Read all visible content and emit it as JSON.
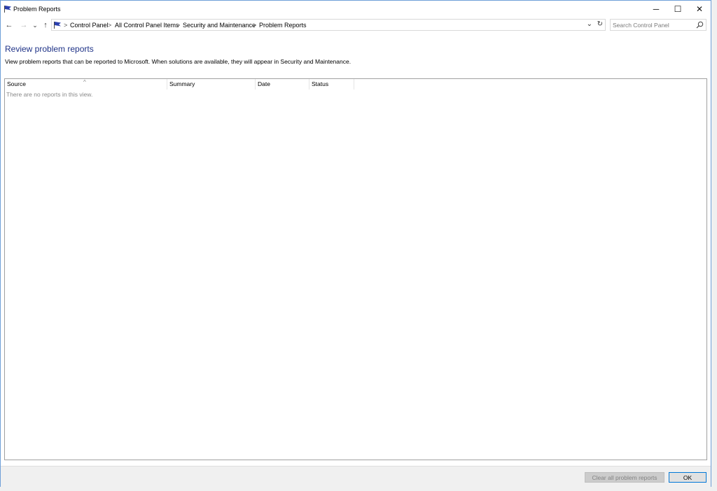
{
  "window": {
    "title": "Problem Reports",
    "controls": {
      "minimize": "─",
      "maximize": "☐",
      "close": "✕"
    }
  },
  "nav": {
    "back": "←",
    "forward": "→",
    "recent": "⌄",
    "up": "↑"
  },
  "address": {
    "crumbs": [
      "Control Panel",
      "All Control Panel Items",
      "Security and Maintenance",
      "Problem Reports"
    ],
    "separator": ">",
    "dropdown": "⌄",
    "refresh": "↻"
  },
  "search": {
    "placeholder": "Search Control Panel",
    "value": ""
  },
  "main": {
    "heading": "Review problem reports",
    "description": "View problem reports that can be reported to Microsoft. When solutions are available, they will appear in Security and Maintenance.",
    "columns": [
      "Source",
      "Summary",
      "Date",
      "Status"
    ],
    "sort_indicator": "^",
    "empty_text": "There are no reports in this view."
  },
  "footer": {
    "clear_label": "Clear all problem reports",
    "ok_label": "OK"
  },
  "colors": {
    "accent": "#0078d7",
    "heading": "#1e3287",
    "flag": "#2a3fae"
  }
}
